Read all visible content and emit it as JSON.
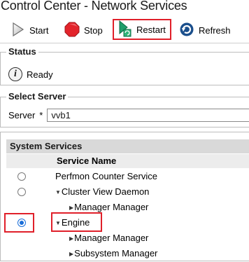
{
  "window": {
    "title": "Control Center - Network Services"
  },
  "toolbar": {
    "start_label": "Start",
    "stop_label": "Stop",
    "restart_label": "Restart",
    "refresh_label": "Refresh"
  },
  "status": {
    "legend": "Status",
    "text": "Ready"
  },
  "server": {
    "legend": "Select Server",
    "label": "Server",
    "required_mark": "*",
    "value": "vvb1"
  },
  "services": {
    "legend": "System Services",
    "column_header": "Service Name",
    "rows": [
      {
        "name": "Perfmon Counter Service",
        "has_radio": true,
        "selected": false,
        "expander": ""
      },
      {
        "name": "Cluster View Daemon",
        "has_radio": true,
        "selected": false,
        "expander": "▼"
      },
      {
        "name": "Manager Manager",
        "has_radio": false,
        "selected": false,
        "expander": "▶"
      },
      {
        "name": "Engine",
        "has_radio": true,
        "selected": true,
        "expander": "▼"
      },
      {
        "name": "Manager Manager",
        "has_radio": false,
        "selected": false,
        "expander": "▶"
      },
      {
        "name": "Subsystem Manager",
        "has_radio": false,
        "selected": false,
        "expander": "▶"
      }
    ]
  },
  "colors": {
    "highlight": "#e0202a",
    "radio_selected": "#1a6ed8",
    "header_bg": "#d9d9d9"
  }
}
